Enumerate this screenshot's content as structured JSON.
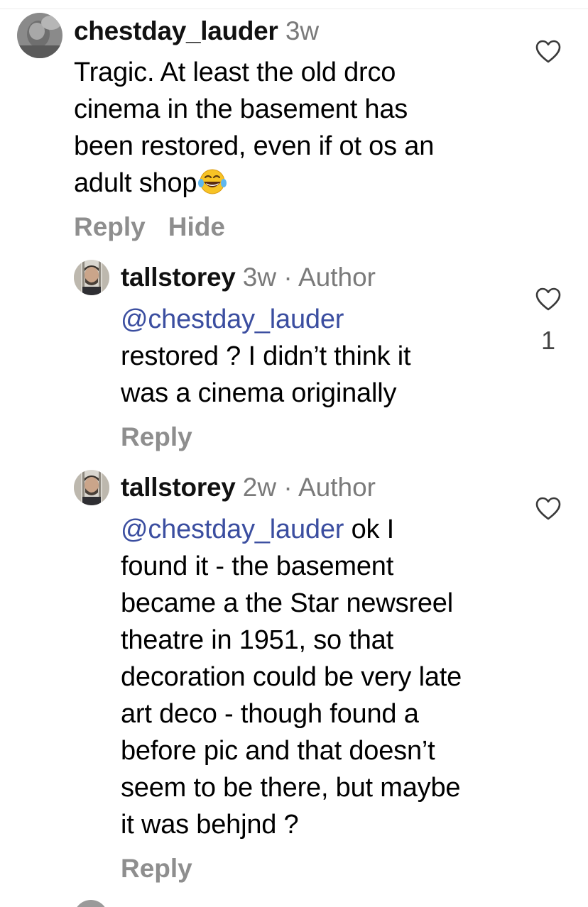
{
  "comments": [
    {
      "username": "chestday_lauder",
      "time": "3w",
      "author_tag": "",
      "mention": "",
      "lines": [
        "Tragic. At least the old drco",
        "cinema in the basement has",
        "been restored, even if ot os an",
        "adult shop"
      ],
      "emoji": "face-with-tears-of-joy",
      "actions": [
        "Reply",
        "Hide"
      ],
      "likes": ""
    },
    {
      "username": "tallstorey",
      "time": "3w",
      "author_tag": " · Author",
      "mention": "@chestday_lauder",
      "lines": [
        "restored ? I didn’t think it",
        "was a cinema originally"
      ],
      "actions": [
        "Reply"
      ],
      "likes": "1"
    },
    {
      "username": "tallstorey",
      "time": "2w",
      "author_tag": " · Author",
      "mention": "@chestday_lauder",
      "mention_tail": " ok I",
      "lines": [
        "found it - the basement",
        "became a the Star newsreel",
        "theatre in 1951, so that",
        "decoration could be very late",
        "art deco - though found a",
        "before pic and that doesn’t",
        "seem to be there, but maybe",
        "it was behjnd ?"
      ],
      "actions": [
        "Reply"
      ],
      "likes": ""
    }
  ],
  "icons": {
    "like": "heart-outline-icon",
    "emoji": "face-with-tears-of-joy"
  },
  "colors": {
    "mention": "#3b4ea0",
    "meta": "#7a7a7a",
    "action": "#8e8e8e"
  }
}
